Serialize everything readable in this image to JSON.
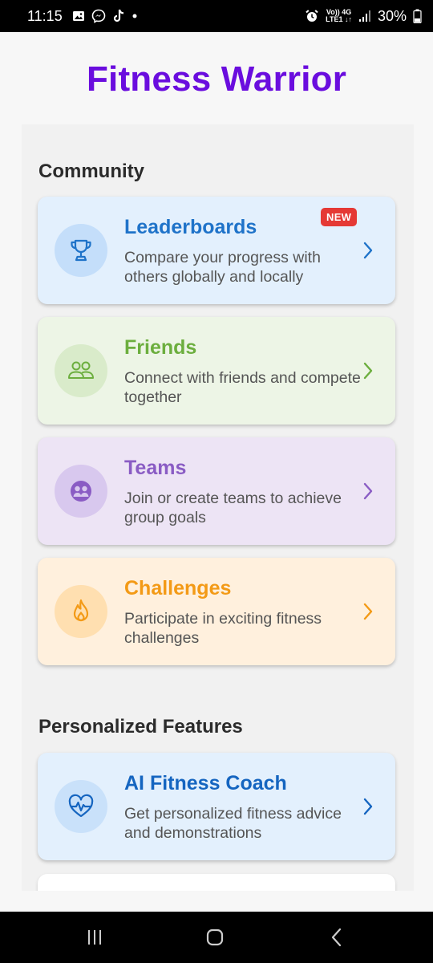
{
  "status_bar": {
    "time": "11:15",
    "network_top": "Vo)) 4G",
    "network_bottom": "LTE1 ↓↑",
    "battery": "30%",
    "icons": [
      "gallery-icon",
      "messenger-icon",
      "tiktok-icon",
      "dot-icon",
      "alarm-icon",
      "signal-icon",
      "battery-icon"
    ]
  },
  "header": {
    "title": "Fitness Warrior"
  },
  "sections": {
    "community": {
      "title": "Community"
    },
    "personalized": {
      "title": "Personalized Features"
    }
  },
  "cards": [
    {
      "title": "Leaderboards",
      "description": "Compare your progress with others globally and locally",
      "badge": "NEW",
      "icon": "trophy-icon",
      "accent": "#1f73c9",
      "bg": "#e3f0fd",
      "icon_bg": "#c4defa"
    },
    {
      "title": "Friends",
      "description": "Connect with friends and compete together",
      "icon": "friends-icon",
      "accent": "#6cae3e",
      "bg": "#edf5e6",
      "icon_bg": "#d9ebca"
    },
    {
      "title": "Teams",
      "description": "Join or create teams to achieve group goals",
      "icon": "team-icon",
      "accent": "#8a5cc4",
      "bg": "#ede4f5",
      "icon_bg": "#d8c8ee"
    },
    {
      "title": "Challenges",
      "description": "Participate in exciting fitness challenges",
      "icon": "flame-icon",
      "accent": "#f39a16",
      "bg": "#fff0dd",
      "icon_bg": "#ffdfb0"
    },
    {
      "title": "AI Fitness Coach",
      "description": "Get personalized fitness advice and demonstrations",
      "icon": "heart-pulse-icon",
      "accent": "#1565c0",
      "bg": "#e3f0fd",
      "icon_bg": "#c9e1fa"
    }
  ],
  "nav": {
    "icons": [
      "recent-apps-icon",
      "home-icon",
      "back-icon"
    ]
  },
  "colors": {
    "title": "#6a0dde",
    "background": "#f7f7f7",
    "panel": "#f1f1f1"
  }
}
